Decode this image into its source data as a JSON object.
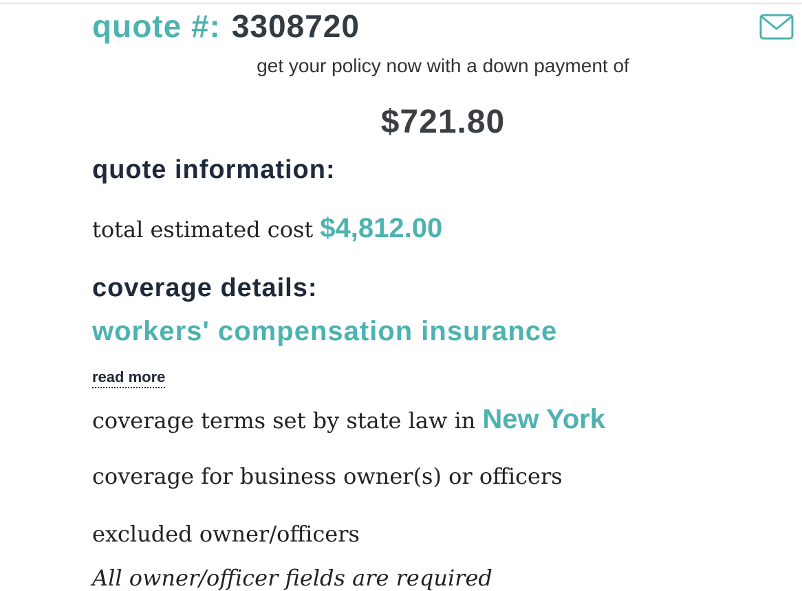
{
  "quote": {
    "label": "quote #:",
    "number": "3308720"
  },
  "down_payment": {
    "text": "get your policy now with a down payment of",
    "amount": "$721.80"
  },
  "quote_info": {
    "heading": "quote information:",
    "total_label": "total estimated cost",
    "total_value": "$4,812.00"
  },
  "coverage": {
    "heading": "coverage details:",
    "product": "workers' compensation insurance",
    "read_more": "read more",
    "state_text": "coverage terms set by state law in",
    "state_value": "New York",
    "owners_text": "coverage for business owner(s) or officers",
    "excluded_text": "excluded owner/officers",
    "cutoff_text": "All owner/officer fields are required"
  },
  "icons": {
    "mail": "envelope-icon"
  },
  "colors": {
    "accent": "#4db3b0",
    "heading": "#1e2a3a",
    "text": "#222222"
  }
}
